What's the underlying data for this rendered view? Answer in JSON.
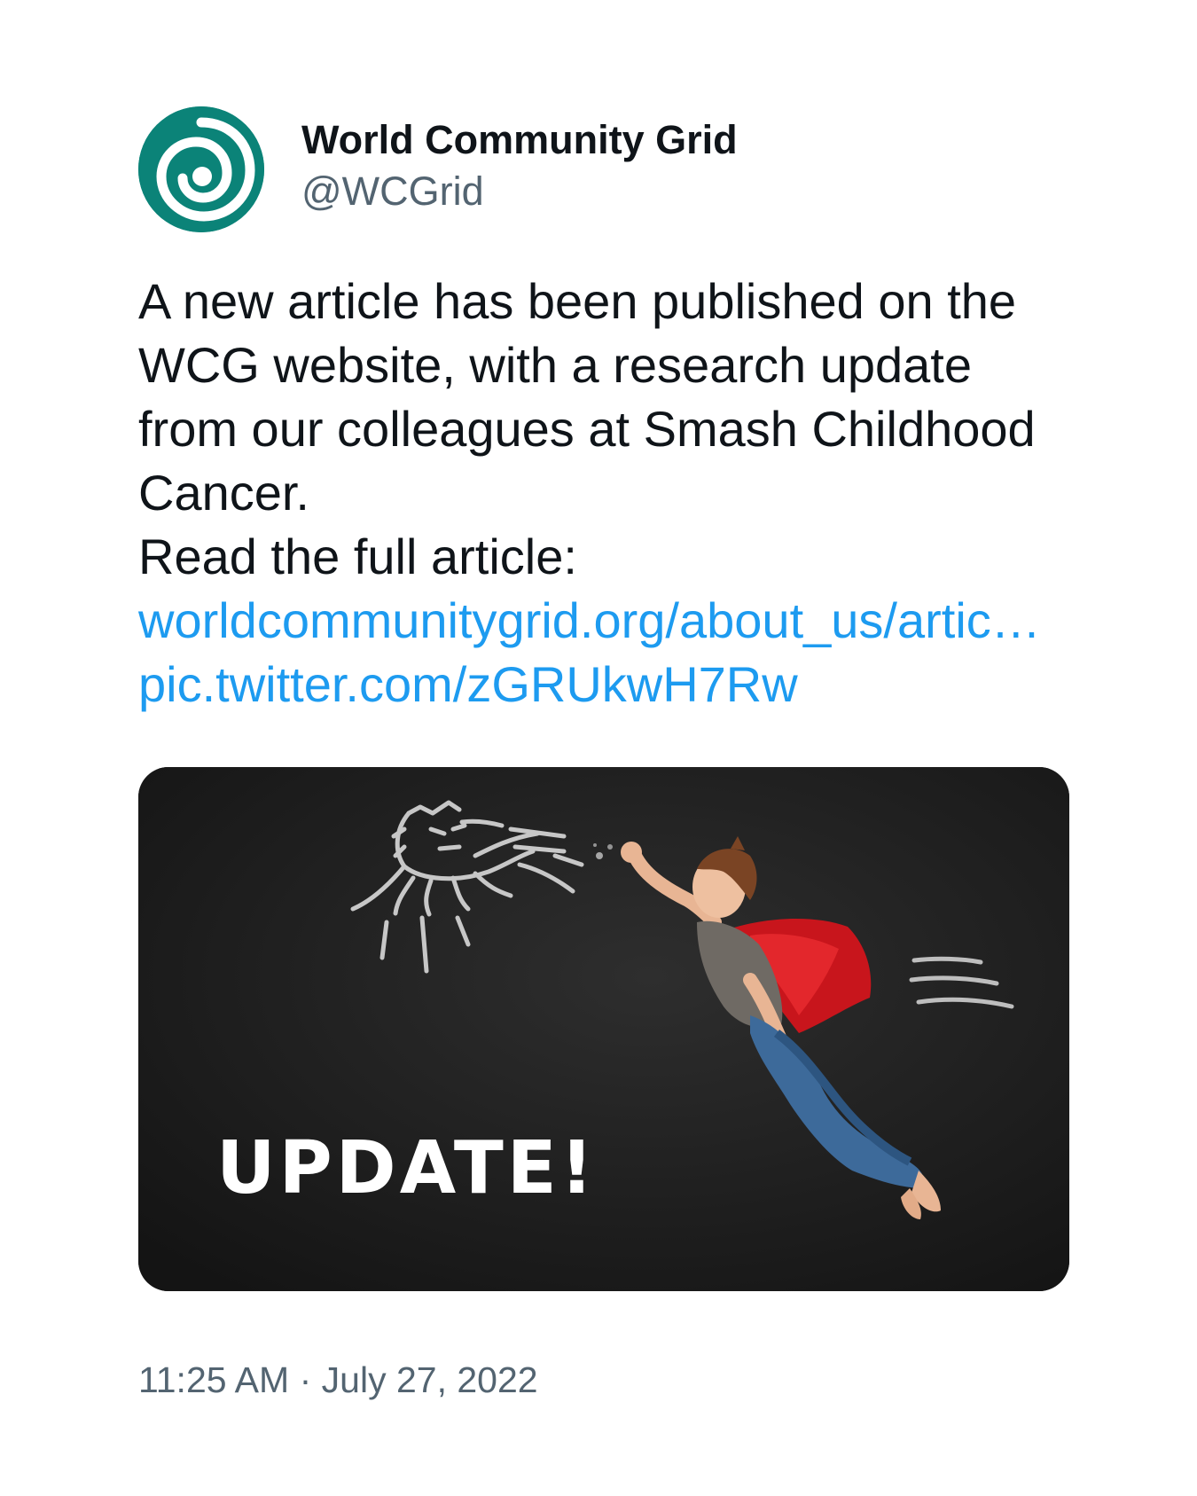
{
  "author": {
    "display_name": "World Community Grid",
    "handle": "@WCGrid",
    "avatar_color": "#0b8378"
  },
  "tweet": {
    "text": "A new article has been published on the WCG website, with a research update from our colleagues at Smash Childhood Cancer.\nRead the full article:",
    "link_article": "worldcommunitygrid.org/about_us/artic…",
    "link_pic": "pic.twitter.com/zGRUkwH7Rw",
    "link_color": "#1d9bf0"
  },
  "media": {
    "overlay_text": "UPDATE!",
    "subject": "boy in red cape flying on chalkboard"
  },
  "meta": {
    "time": "11:25 AM",
    "separator": "·",
    "date": "July 27, 2022"
  }
}
